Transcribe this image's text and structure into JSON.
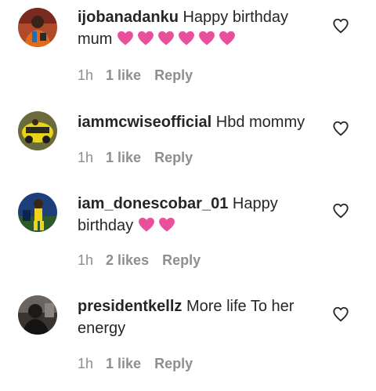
{
  "comments": [
    {
      "username": "ijobanadanku",
      "text": "Happy birthday mum",
      "hearts": 6,
      "time": "1h",
      "likes": "1 like",
      "reply": "Reply"
    },
    {
      "username": "iammcwiseofficial",
      "text": "Hbd mommy",
      "hearts": 0,
      "time": "1h",
      "likes": "1 like",
      "reply": "Reply"
    },
    {
      "username": "iam_donescobar_01",
      "text": "Happy birthday",
      "hearts": 2,
      "time": "1h",
      "likes": "2 likes",
      "reply": "Reply"
    },
    {
      "username": "presidentkellz",
      "text": "More life To her energy",
      "hearts": 0,
      "time": "1h",
      "likes": "1 like",
      "reply": "Reply"
    }
  ],
  "colors": {
    "text": "#262626",
    "meta": "#8e8e8e",
    "heart_emoji": "#e8509b"
  },
  "icons": {
    "heart_emoji": "pink-heart-icon",
    "like_button": "heart-outline-icon"
  }
}
